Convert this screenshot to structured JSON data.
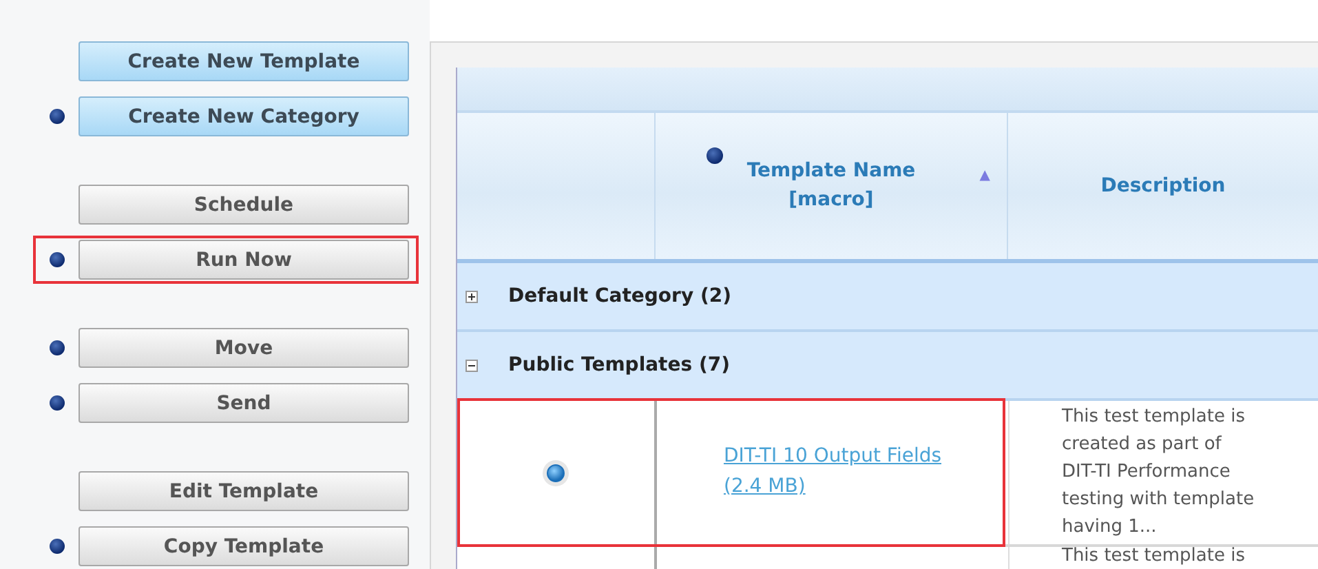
{
  "action_groups": [
    {
      "actions": [
        {
          "label": "Create New Template",
          "kind": "primary",
          "info": false,
          "highlighted": false
        },
        {
          "label": "Create New Category",
          "kind": "primary",
          "info": true,
          "highlighted": false
        }
      ]
    },
    {
      "actions": [
        {
          "label": "Schedule",
          "kind": "secondary",
          "info": false,
          "highlighted": false
        },
        {
          "label": "Run Now",
          "kind": "secondary",
          "info": true,
          "highlighted": true
        }
      ]
    },
    {
      "actions": [
        {
          "label": "Move",
          "kind": "secondary",
          "info": true,
          "highlighted": false
        },
        {
          "label": "Send",
          "kind": "secondary",
          "info": true,
          "highlighted": false
        }
      ]
    },
    {
      "actions": [
        {
          "label": "Edit Template",
          "kind": "secondary",
          "info": false,
          "highlighted": false
        },
        {
          "label": "Copy Template",
          "kind": "secondary",
          "info": true,
          "highlighted": false
        }
      ]
    }
  ],
  "table": {
    "columns": [
      {
        "label": "Template Name\n[macro]",
        "info": true,
        "sort_arrow": "▲"
      },
      {
        "label": "Description",
        "info": false
      }
    ],
    "groups": [
      {
        "label": "Default Category (2)",
        "expanded": false
      },
      {
        "label": "Public Templates (7)",
        "expanded": true,
        "rows": [
          {
            "selected": true,
            "highlighted": true,
            "name": "DIT-TI 10 Output Fields\n(2.4 MB)",
            "description": [
              "This test template is",
              "created as part of",
              "DIT-TI Performance",
              "testing with template",
              "having 1..."
            ]
          },
          {
            "description": [
              "This test template is"
            ]
          }
        ]
      }
    ]
  }
}
